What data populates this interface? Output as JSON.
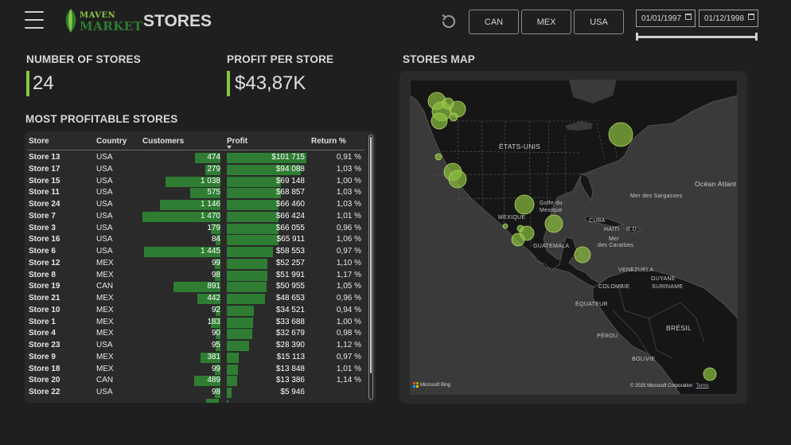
{
  "header": {
    "logo_line1": "MAVEN",
    "logo_line2": "MARKET",
    "title": "STORES",
    "country_buttons": [
      "CAN",
      "MEX",
      "USA"
    ],
    "date_start": "01/01/1997",
    "date_end": "01/12/1998"
  },
  "kpis": {
    "stores_label": "NUMBER OF STORES",
    "stores_value": "24",
    "profit_label": "PROFIT PER STORE",
    "profit_value": "$43,87K"
  },
  "table": {
    "title": "MOST PROFITABLE STORES",
    "columns": [
      "Store",
      "Country",
      "Customers",
      "Profit",
      "Return %"
    ],
    "rows": [
      {
        "store": "Store 13",
        "country": "USA",
        "customers": "474",
        "profit": "$101 715",
        "return": "0,91 %",
        "cust_n": 474,
        "profit_n": 101715
      },
      {
        "store": "Store 17",
        "country": "USA",
        "customers": "279",
        "profit": "$94 088",
        "return": "1,03 %",
        "cust_n": 279,
        "profit_n": 94088
      },
      {
        "store": "Store 15",
        "country": "USA",
        "customers": "1 038",
        "profit": "$69 148",
        "return": "1,00 %",
        "cust_n": 1038,
        "profit_n": 69148
      },
      {
        "store": "Store 11",
        "country": "USA",
        "customers": "575",
        "profit": "$68 857",
        "return": "1,03 %",
        "cust_n": 575,
        "profit_n": 68857
      },
      {
        "store": "Store 24",
        "country": "USA",
        "customers": "1 146",
        "profit": "$66 460",
        "return": "1,03 %",
        "cust_n": 1146,
        "profit_n": 66460
      },
      {
        "store": "Store 7",
        "country": "USA",
        "customers": "1 470",
        "profit": "$66 424",
        "return": "1,01 %",
        "cust_n": 1470,
        "profit_n": 66424
      },
      {
        "store": "Store 3",
        "country": "USA",
        "customers": "179",
        "profit": "$66 055",
        "return": "0,96 %",
        "cust_n": 179,
        "profit_n": 66055
      },
      {
        "store": "Store 16",
        "country": "USA",
        "customers": "84",
        "profit": "$65 911",
        "return": "1,06 %",
        "cust_n": 84,
        "profit_n": 65911
      },
      {
        "store": "Store 6",
        "country": "USA",
        "customers": "1 445",
        "profit": "$58 553",
        "return": "0,97 %",
        "cust_n": 1445,
        "profit_n": 58553
      },
      {
        "store": "Store 12",
        "country": "MEX",
        "customers": "99",
        "profit": "$52 257",
        "return": "1,10 %",
        "cust_n": 99,
        "profit_n": 52257
      },
      {
        "store": "Store 8",
        "country": "MEX",
        "customers": "98",
        "profit": "$51 991",
        "return": "1,17 %",
        "cust_n": 98,
        "profit_n": 51991
      },
      {
        "store": "Store 19",
        "country": "CAN",
        "customers": "891",
        "profit": "$50 955",
        "return": "1,05 %",
        "cust_n": 891,
        "profit_n": 50955
      },
      {
        "store": "Store 21",
        "country": "MEX",
        "customers": "442",
        "profit": "$48 653",
        "return": "0,96 %",
        "cust_n": 442,
        "profit_n": 48653
      },
      {
        "store": "Store 10",
        "country": "MEX",
        "customers": "92",
        "profit": "$34 521",
        "return": "0,94 %",
        "cust_n": 92,
        "profit_n": 34521
      },
      {
        "store": "Store 1",
        "country": "MEX",
        "customers": "183",
        "profit": "$33 688",
        "return": "1,00 %",
        "cust_n": 183,
        "profit_n": 33688
      },
      {
        "store": "Store 4",
        "country": "MEX",
        "customers": "90",
        "profit": "$32 679",
        "return": "0,98 %",
        "cust_n": 90,
        "profit_n": 32679
      },
      {
        "store": "Store 23",
        "country": "USA",
        "customers": "95",
        "profit": "$28 390",
        "return": "1,12 %",
        "cust_n": 95,
        "profit_n": 28390
      },
      {
        "store": "Store 9",
        "country": "MEX",
        "customers": "381",
        "profit": "$15 113",
        "return": "0,97 %",
        "cust_n": 381,
        "profit_n": 15113
      },
      {
        "store": "Store 18",
        "country": "MEX",
        "customers": "99",
        "profit": "$13 848",
        "return": "1,01 %",
        "cust_n": 99,
        "profit_n": 13848
      },
      {
        "store": "Store 20",
        "country": "CAN",
        "customers": "489",
        "profit": "$13 386",
        "return": "1,14 %",
        "cust_n": 489,
        "profit_n": 13386
      },
      {
        "store": "Store 22",
        "country": "USA",
        "customers": "98",
        "profit": "$5 946",
        "return": "",
        "cust_n": 98,
        "profit_n": 5946
      }
    ]
  },
  "map": {
    "title": "STORES MAP",
    "labels": {
      "usa": "ÉTATS-UNIS",
      "ocean": "Océan Atlant",
      "mer_sargasses": "Mer des Sargasses",
      "golfe": "Golfe du",
      "mexique_golfe": "Mexique",
      "mexique": "MEXIQUE",
      "cuba": "CUBA",
      "haiti": "HAÏTI",
      "rd": "R.D.",
      "mer_caraibes1": "Mer",
      "mer_caraibes2": "des Caraïbes",
      "guatemala": "GUATEMALA",
      "venezuela": "VENEZUELA",
      "guyane": "GUYANE",
      "colombie": "COLOMBIE",
      "suriname": "SURINAME",
      "equateur": "ÉQUATEUR",
      "bresil": "BRÉSIL",
      "perou": "PÉROU",
      "bolivie": "BOLIVIE"
    },
    "provider": "Microsoft Bing",
    "copyright": "© 2025 Microsoft Corporation",
    "terms": "Terms"
  },
  "colors": {
    "accent": "#8cc63f",
    "bar": "#2e7d32",
    "bubble": "#8cbf3f",
    "background": "#1f1f1f",
    "card": "#2a2a2a"
  }
}
